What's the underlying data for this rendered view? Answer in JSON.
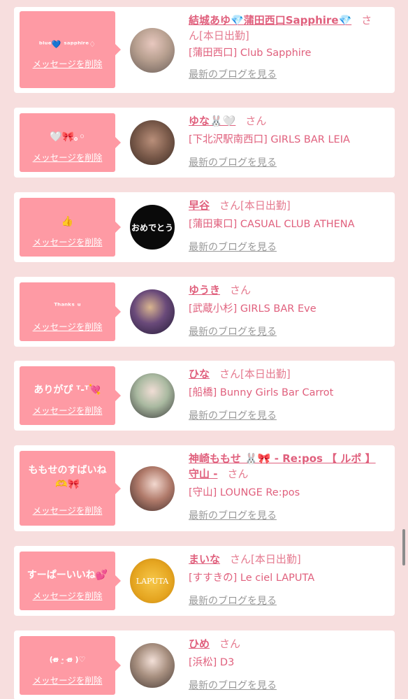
{
  "delete_label": "メッセージを削除",
  "blog_label": "最新のブログを見る",
  "suffix_label": "さん",
  "colors": {
    "background": "#f7dede",
    "card": "#ffffff",
    "bubble": "#fe9aa4",
    "accent": "#e0607d",
    "link_gray": "#999999"
  },
  "messages": [
    {
      "message": "ᵇˡᵘᵉ💙 ˢᵃᵖᵖʰⁱʳᵉ♢",
      "name_prefix": "結城あゆ",
      "name_middle": "蒲田西口Sapphire",
      "name_suffix_icon": "diamond-icon",
      "suffix_trail": "さ",
      "suffix_wrap": "ん",
      "badge": "[本日出勤]",
      "shop": "[蒲田西口] Club Sapphire",
      "avatar_icon": "avatar-photo"
    },
    {
      "message": "🤍🎀｡◦",
      "name": "ゆな🐰🤍",
      "badge": "",
      "shop": "[下北沢駅南西口] GIRLS BAR LEIA",
      "avatar_icon": "avatar-photo"
    },
    {
      "message": "👍",
      "name": "早谷",
      "badge": "[本日出勤]",
      "shop": "[蒲田東口] CASUAL CLUB ATHENA",
      "avatar_text": "おめでとう"
    },
    {
      "message": "ᵀʰᵃⁿᵏˢ ᵘ",
      "name": "ゆうき",
      "badge": "",
      "shop": "[武蔵小杉] GIRLS BAR Eve",
      "avatar_icon": "avatar-photo"
    },
    {
      "message": "ありがぴ ᵀ-ᵀ💘",
      "name": "ひな",
      "badge": "[本日出勤]",
      "shop": "[船橋] Bunny Girls Bar Carrot",
      "avatar_icon": "avatar-photo"
    },
    {
      "message": "ももせのすばいね",
      "message_line2": "🫶🎀",
      "name": "神崎ももせ 🐰🎀 - Re:pos 【 ルポ 】",
      "name_line2": "守山 -",
      "badge": "",
      "shop": "[守山] LOUNGE Re:pos",
      "avatar_icon": "avatar-photo"
    },
    {
      "message": "すーぱーいいね💕",
      "name": "まいな",
      "badge": "[本日出勤]",
      "shop": "[すすきの] Le ciel LAPUTA",
      "avatar_text": "LAPUTA"
    },
    {
      "message": "(ɞ̴̶̷ ·̮ ɞ̴̶̷ )♡",
      "name": "ひめ",
      "badge": "",
      "shop": "[浜松] D3",
      "avatar_icon": "avatar-photo"
    }
  ]
}
